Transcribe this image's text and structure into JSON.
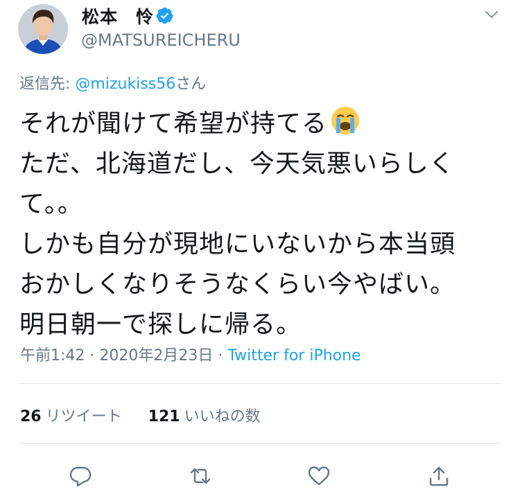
{
  "tweet": {
    "author": {
      "display_name": "松本　怜",
      "handle": "@MATSUREICHERU",
      "avatar": "player-portrait",
      "verified": true
    },
    "reply_to": {
      "prefix": "返信先: ",
      "mention": "@mizukiss56",
      "suffix": "さん"
    },
    "body_lines": [
      "それが聞けて希望が持てる",
      "ただ、北海道だし、今天気悪いらしく",
      "て。。",
      "しかも自分が現地にいないから本当頭",
      "おかしくなりそうなくらい今やばい。",
      "明日朝一で探しに帰る。"
    ],
    "emoji": "crying-face",
    "time": "午前1:42",
    "separator": " · ",
    "date": "2020年2月23日",
    "source": "Twitter for iPhone",
    "retweets": {
      "count": "26",
      "label": "リツイート"
    },
    "likes": {
      "count": "121",
      "label": "いいねの数"
    }
  },
  "icons": {
    "menu": "chevron-down-icon",
    "reply": "reply-icon",
    "retweet": "retweet-icon",
    "like": "heart-icon",
    "share": "share-icon"
  },
  "colors": {
    "accent": "#1da1f2",
    "secondary_text": "#657786",
    "primary_text": "#14171a",
    "divider": "#e1e8ed"
  }
}
